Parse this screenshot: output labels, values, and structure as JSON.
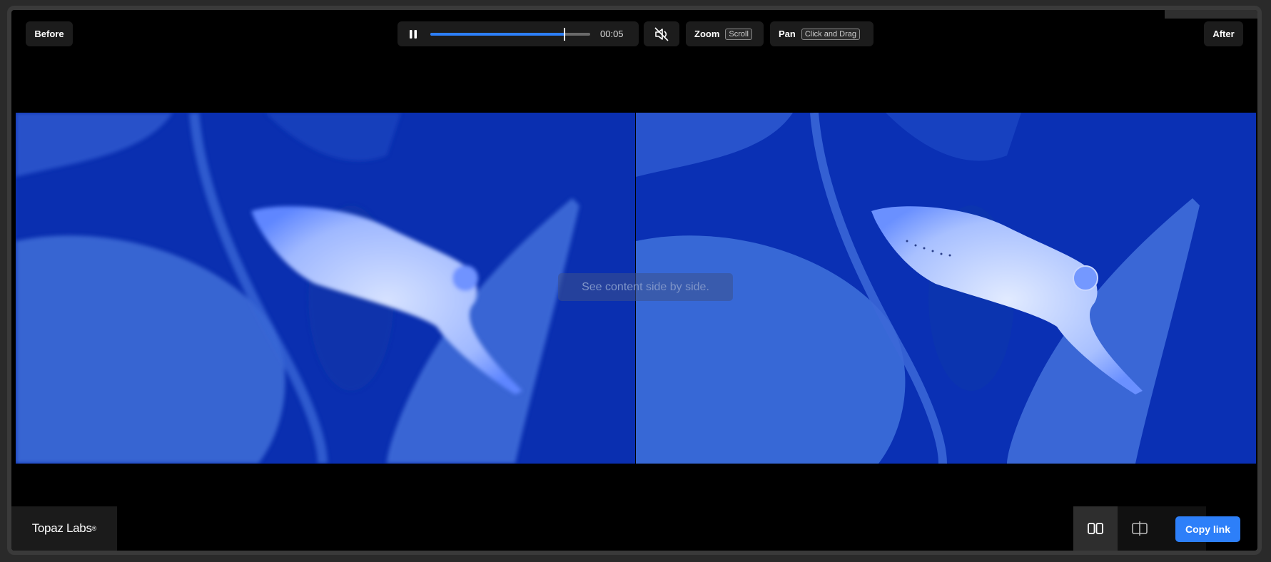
{
  "labels": {
    "before": "Before",
    "after": "After"
  },
  "player": {
    "time": "00:05",
    "progress": 0.84
  },
  "zoom": {
    "label": "Zoom",
    "hint": "Scroll"
  },
  "pan": {
    "label": "Pan",
    "hint": "Click and Drag"
  },
  "overlay_hint": "See content side by side.",
  "brand": {
    "name": "Topaz Labs",
    "mark": "®"
  },
  "footer": {
    "copy_label": "Copy link",
    "active_mode": "side-by-side"
  },
  "icons": [
    "pause-icon",
    "mute-icon",
    "side-by-side-icon",
    "split-view-icon",
    "overlay-view-icon"
  ],
  "colors": {
    "accent": "#2d7ff9",
    "progress": "#2d7ff9",
    "water": "#0a2fb0"
  }
}
